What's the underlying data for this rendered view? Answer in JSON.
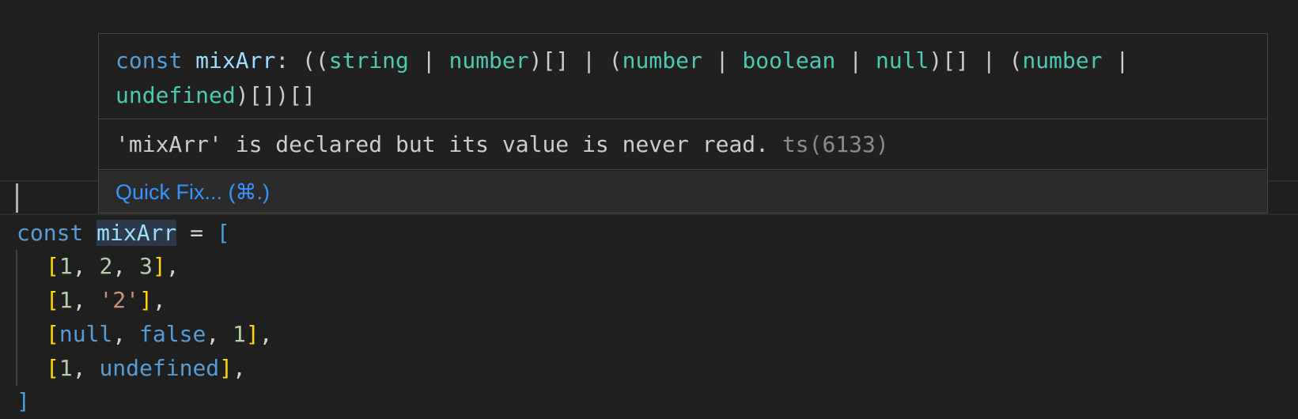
{
  "code": {
    "line0": {
      "kw": "const",
      "name": "mixArr",
      "eq": " = ",
      "open": "["
    },
    "line1": {
      "open": "[",
      "a": "1",
      "sep1": ", ",
      "b": "2",
      "sep2": ", ",
      "c": "3",
      "close": "]",
      "end": ","
    },
    "line2": {
      "open": "[",
      "a": "1",
      "sep1": ", ",
      "b": "'2'",
      "close": "]",
      "end": ","
    },
    "line3": {
      "open": "[",
      "a": "null",
      "sep1": ", ",
      "b": "false",
      "sep2": ", ",
      "c": "1",
      "close": "]",
      "end": ","
    },
    "line4": {
      "open": "[",
      "a": "1",
      "sep1": ", ",
      "b": "undefined",
      "close": "]",
      "end": ","
    },
    "line5": {
      "close": "]"
    }
  },
  "hover": {
    "signature": {
      "kw": "const",
      "name": "mixArr",
      "p1": ": ((",
      "t1": "string",
      "p2": " | ",
      "t2": "number",
      "p3": ")[] | (",
      "t3": "number",
      "p4": " | ",
      "t4": "boolean",
      "p5": " | ",
      "t5": "null",
      "p6": ")[] | (",
      "t6": "number",
      "p7": " | ",
      "t7": "undefined",
      "p8": ")[])[]"
    },
    "message": "'mixArr' is declared but its value is never read.",
    "error_code": "ts(6133)",
    "quick_fix_label": "Quick Fix... (⌘.)"
  },
  "colors": {
    "keyword": "#569cd6",
    "variable": "#9cdcfe",
    "type": "#4ec9b0",
    "number": "#b5cea8",
    "string": "#ce9178",
    "bracket_level1": "#ffd700",
    "bracket_level0": "#479dde",
    "link": "#3794ff"
  }
}
